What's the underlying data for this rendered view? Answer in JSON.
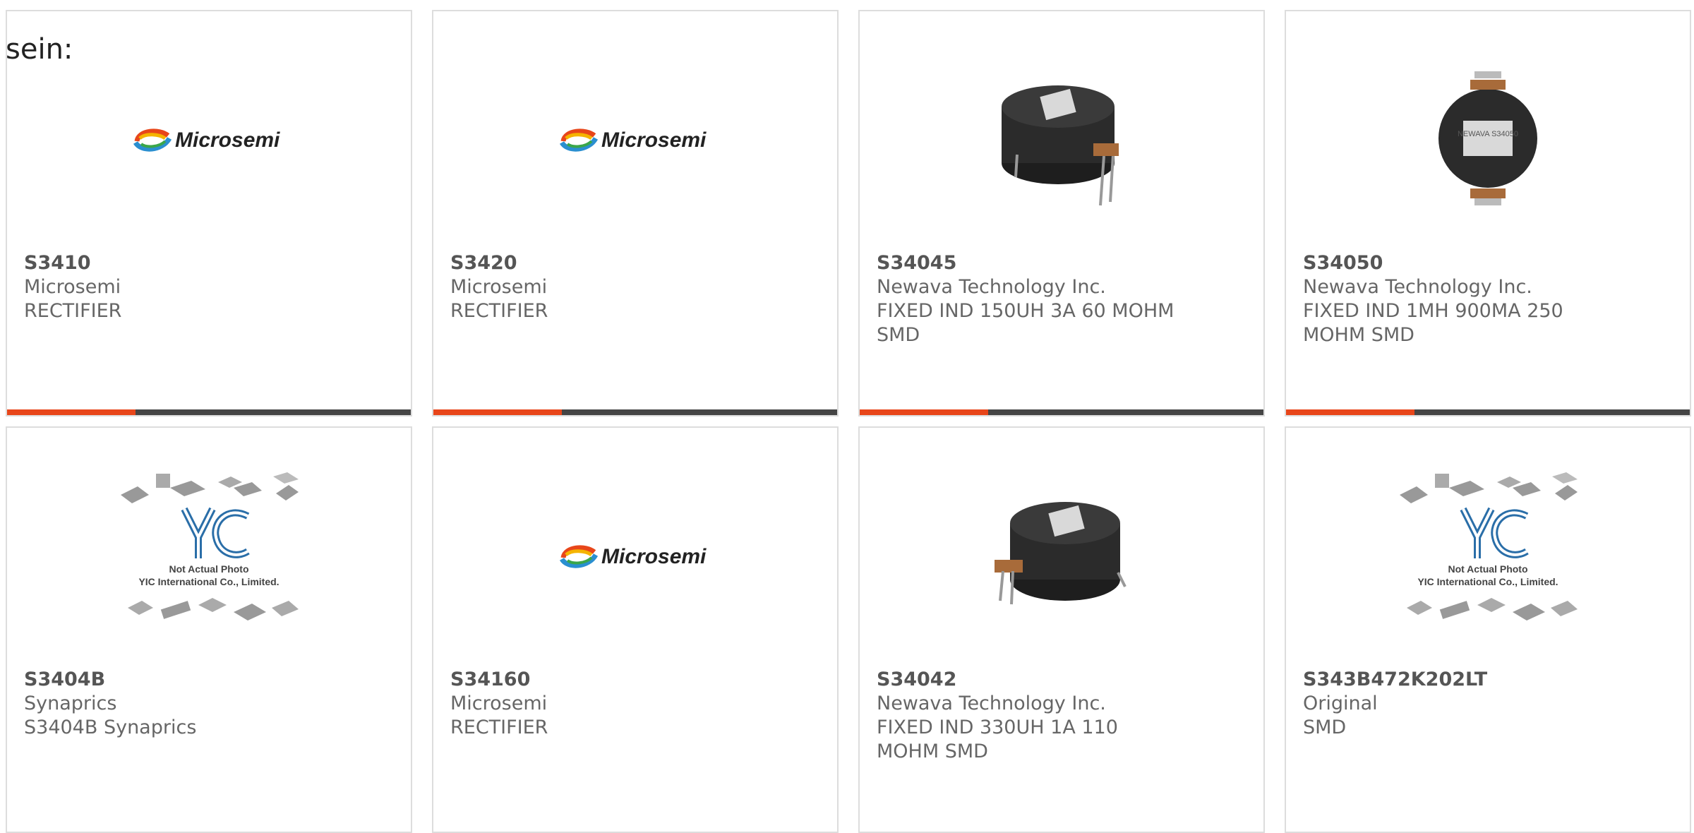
{
  "heading": "sein:",
  "colors": {
    "accent": "#e8461a",
    "bar": "#454545",
    "border": "#dddddd",
    "text": "#666666"
  },
  "products": [
    {
      "part": "S3410",
      "maker": "Microsemi",
      "desc": "RECTIFIER",
      "image": "microsemi-logo"
    },
    {
      "part": "S3420",
      "maker": "Microsemi",
      "desc": "RECTIFIER",
      "image": "microsemi-logo"
    },
    {
      "part": "S34045",
      "maker": "Newava Technology Inc.",
      "desc": "FIXED IND 150UH 3A 60 MOHM SMD",
      "image": "inductor-photo"
    },
    {
      "part": "S34050",
      "maker": "Newava Technology Inc.",
      "desc": "FIXED IND 1MH 900MA 250 MOHM SMD",
      "image": "inductor-top-photo",
      "label": "NEWAVA S34050"
    },
    {
      "part": "S3404B",
      "maker": "Synaprics",
      "desc": "S3404B Synaprics",
      "image": "placeholder-photo",
      "placeholder_line1": "Not Actual Photo",
      "placeholder_line2": "YIC International Co., Limited."
    },
    {
      "part": "S34160",
      "maker": "Microsemi",
      "desc": "RECTIFIER",
      "image": "microsemi-logo"
    },
    {
      "part": "S34042",
      "maker": "Newava Technology Inc.",
      "desc": "FIXED IND 330UH 1A 110 MOHM SMD",
      "image": "inductor-photo"
    },
    {
      "part": "S343B472K202LT",
      "maker": "Original",
      "desc": "SMD",
      "image": "placeholder-photo",
      "placeholder_line1": "Not Actual Photo",
      "placeholder_line2": "YIC International Co., Limited."
    }
  ],
  "microsemi_logo_text": "Microsemi"
}
